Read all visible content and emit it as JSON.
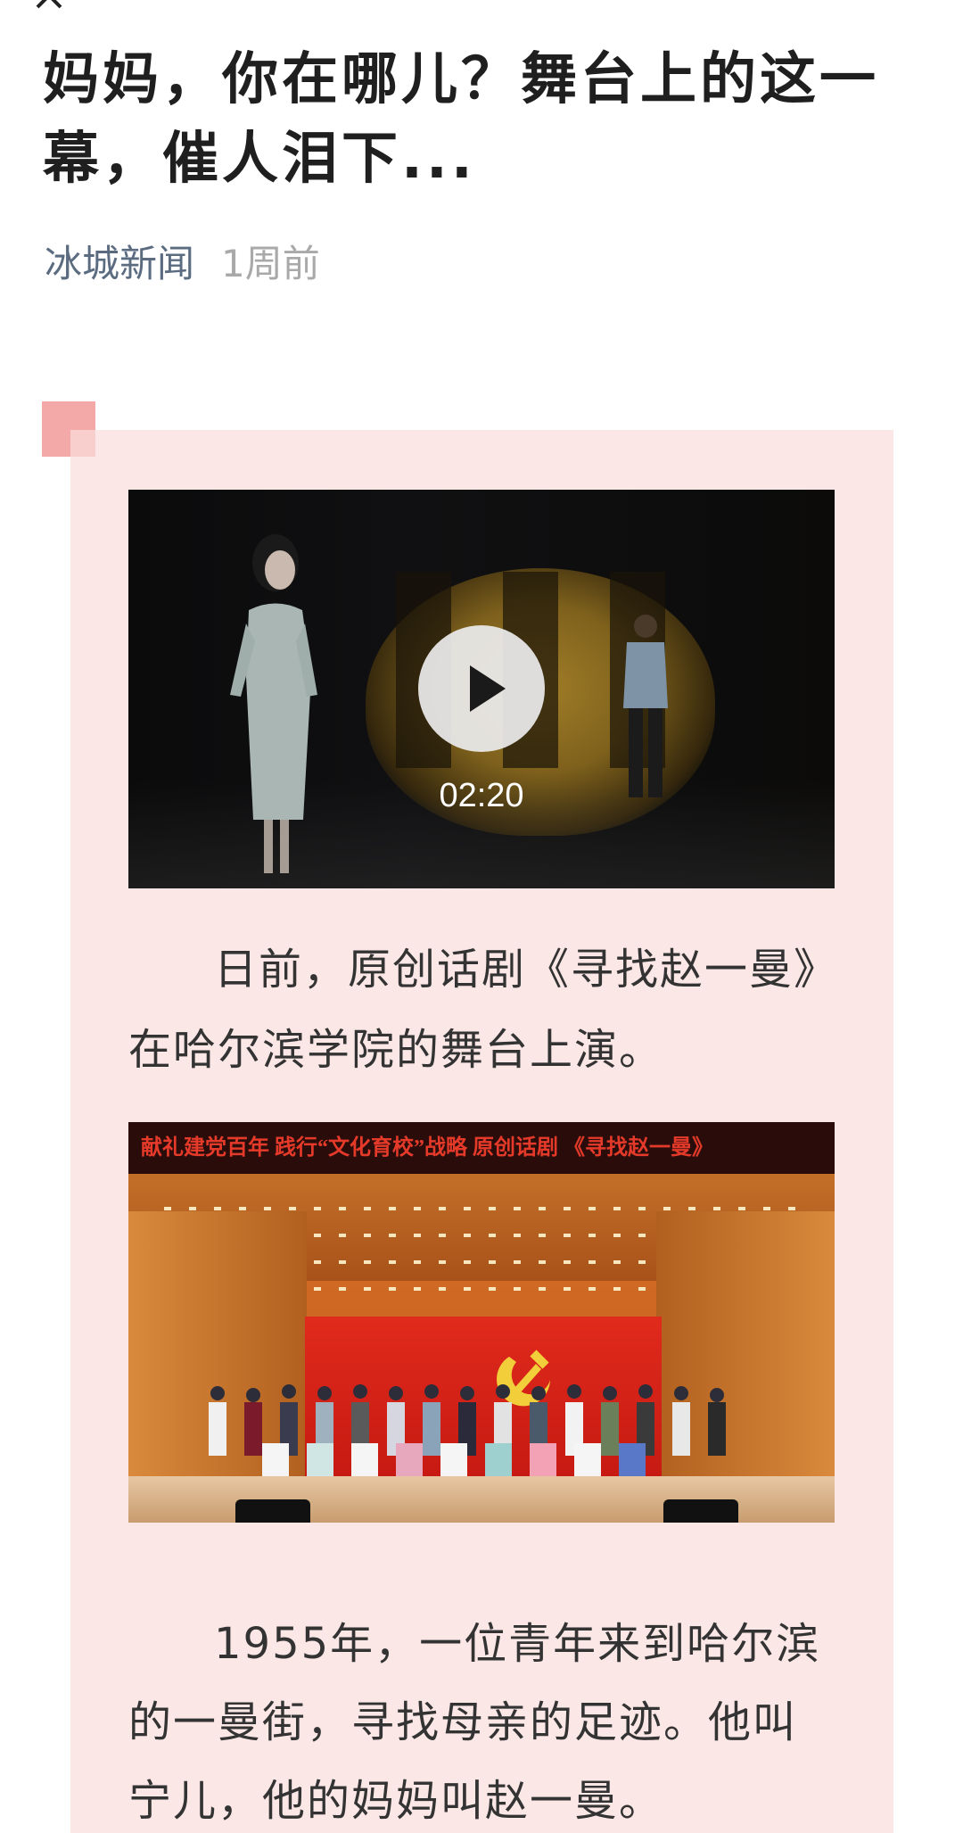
{
  "article": {
    "title": "妈妈，你在哪儿？舞台上的这一幕，催人泪下...",
    "source": "冰城新闻",
    "time": "1周前"
  },
  "video": {
    "duration": "02:20"
  },
  "paragraphs": {
    "p1": "日前，原创话剧《寻找赵一曼》在哈尔滨学院的舞台上演。",
    "p2": "1955年，一位青年来到哈尔滨的一曼街，寻找母亲的足迹。他叫宁儿，他的妈妈叫赵一曼。"
  },
  "photo": {
    "banner": "献礼建党百年  践行“文化育校”战略  原创话剧  《寻找赵一曼》"
  },
  "colors": {
    "card_bg": "#fbe7e6",
    "corner_accent": "#f2a9a8",
    "source_text": "#5b6b80",
    "time_text": "#a9a9a9"
  },
  "icons": [
    "close-icon",
    "play-icon"
  ]
}
